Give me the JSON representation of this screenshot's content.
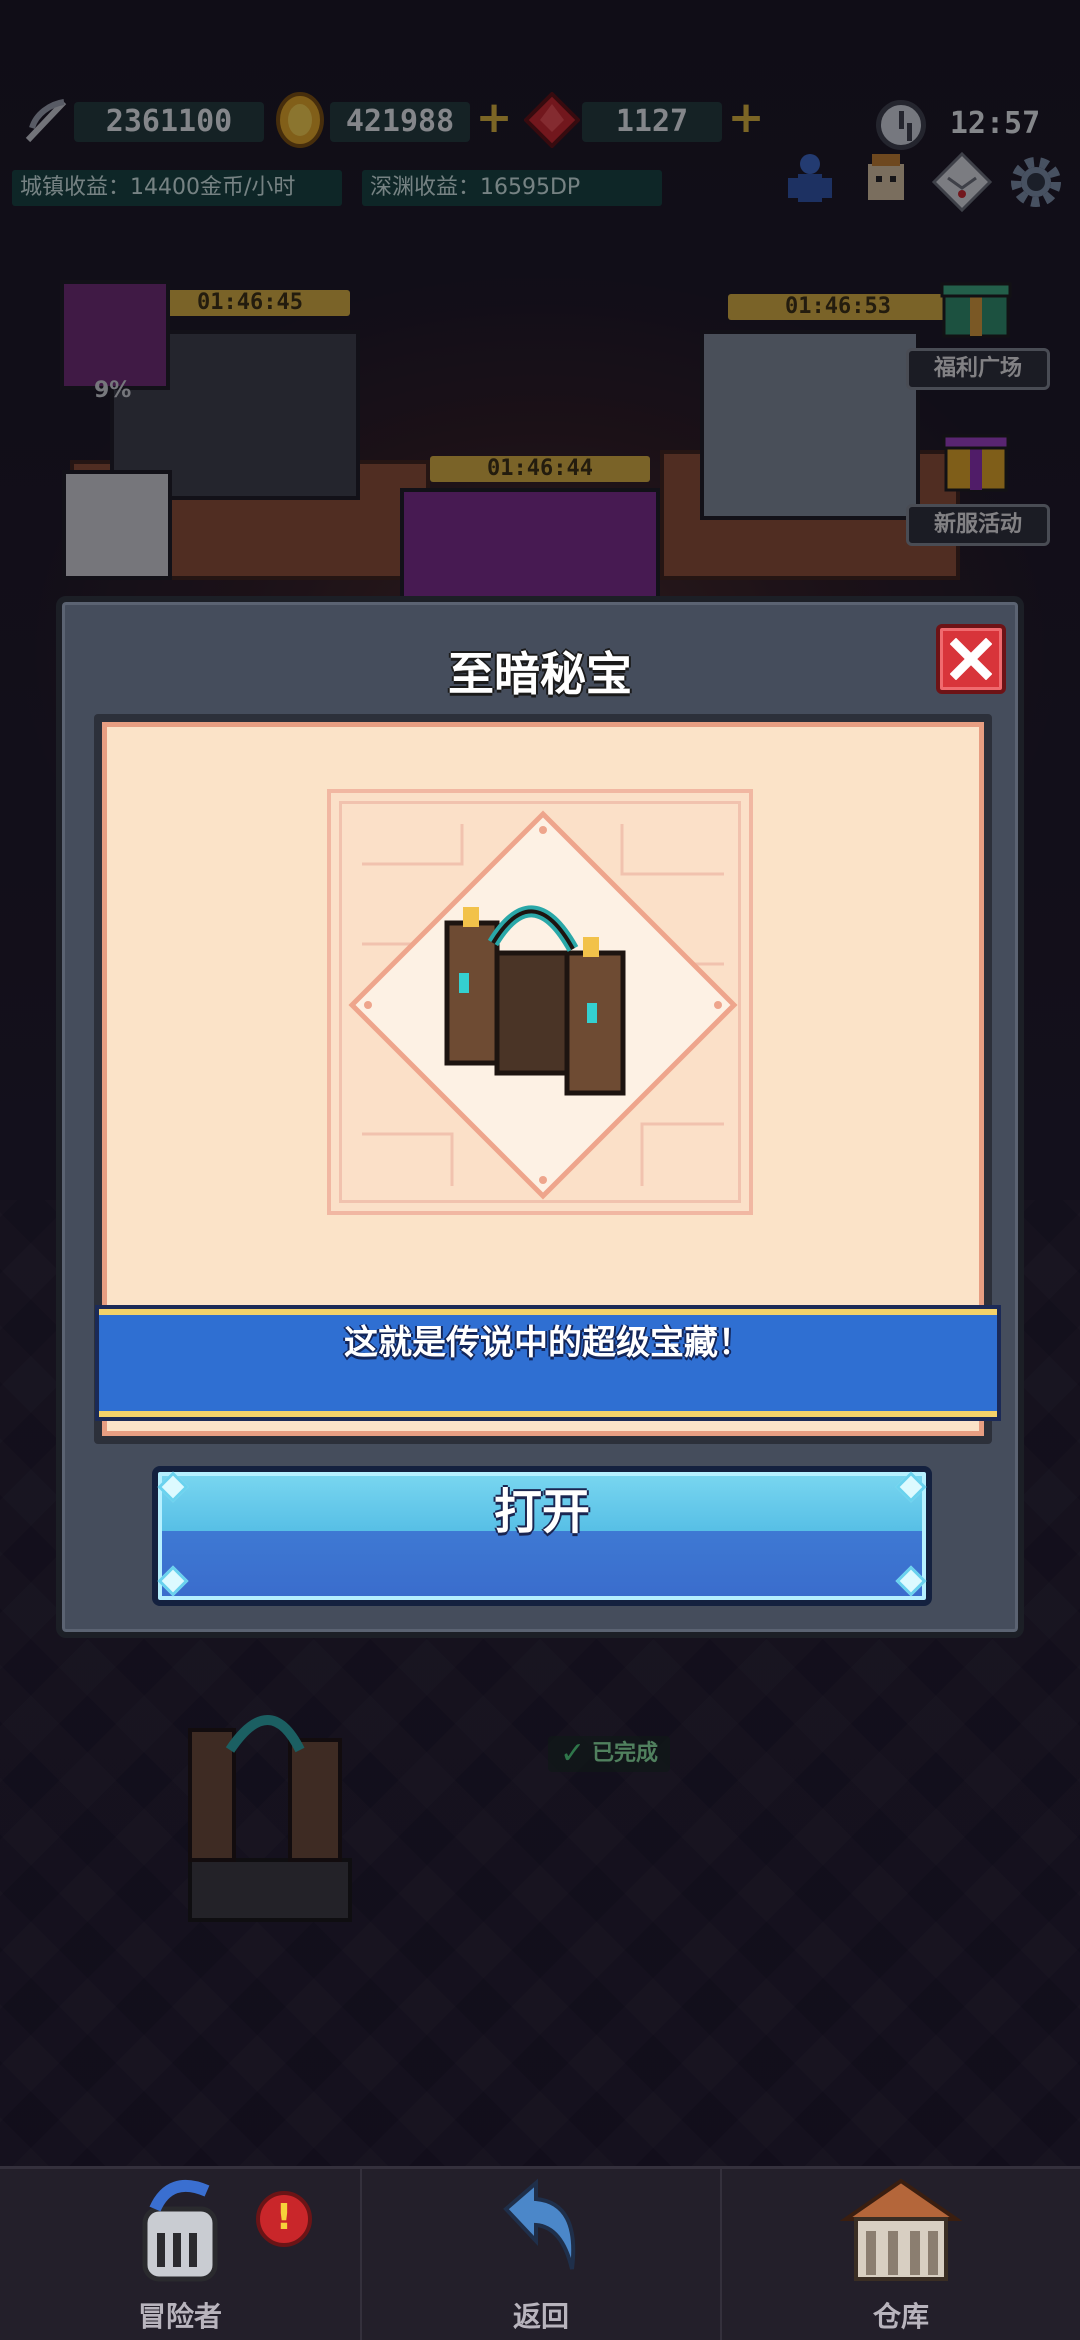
{
  "hud": {
    "resource_souls": "2361100",
    "resource_gold": "421988",
    "resource_gems": "1127",
    "time": "12:57",
    "town_income": "城镇收益：14400金币/小时",
    "abyss_income": "深渊收益：16595DP"
  },
  "scene": {
    "timer_left": "01:46:45",
    "timer_middle": "01:46:44",
    "timer_right": "01:46:53",
    "progress_label": "9%",
    "welfare_label": "福利广场",
    "new_server_label": "新服活动",
    "done_label": "已完成"
  },
  "dialog": {
    "title": "至暗秘宝",
    "banner_text": "这就是传说中的超级宝藏！",
    "open_label": "打开"
  },
  "nav": {
    "adventurer": "冒险者",
    "back": "返回",
    "warehouse": "仓库",
    "alert": "!"
  },
  "colors": {
    "accent_blue": "#2f6fd2",
    "close_red": "#d8343a",
    "panel_cream": "#fbe3c8"
  }
}
